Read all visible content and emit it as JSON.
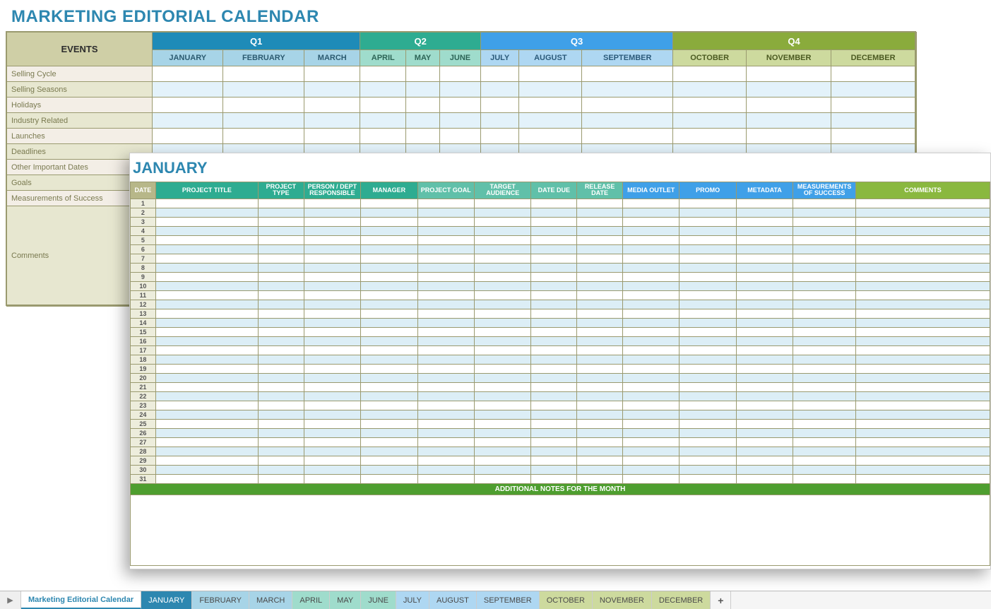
{
  "title": "MARKETING EDITORIAL CALENDAR",
  "eventsHeader": "EVENTS",
  "quarters": {
    "q1": {
      "label": "Q1",
      "months": [
        "JANUARY",
        "FEBRUARY",
        "MARCH"
      ]
    },
    "q2": {
      "label": "Q2",
      "months": [
        "APRIL",
        "MAY",
        "JUNE"
      ]
    },
    "q3": {
      "label": "Q3",
      "months": [
        "JULY",
        "AUGUST",
        "SEPTEMBER"
      ]
    },
    "q4": {
      "label": "Q4",
      "months": [
        "OCTOBER",
        "NOVEMBER",
        "DECEMBER"
      ]
    }
  },
  "rows": [
    "Selling Cycle",
    "Selling Seasons",
    "Holidays",
    "Industry Related",
    "Launches",
    "Deadlines",
    "Other Important Dates",
    "Goals",
    "Measurements of Success",
    "Comments"
  ],
  "overlay": {
    "title": "JANUARY",
    "headers": [
      "DATE",
      "PROJECT TITLE",
      "PROJECT TYPE",
      "PERSON / DEPT RESPONSIBLE",
      "MANAGER",
      "PROJECT GOAL",
      "TARGET AUDIENCE",
      "DATE DUE",
      "RELEASE DATE",
      "MEDIA OUTLET",
      "PROMO",
      "METADATA",
      "MEASUREMENTS OF SUCCESS",
      "COMMENTS"
    ],
    "days": 31,
    "notesLabel": "ADDITIONAL NOTES FOR THE MONTH"
  },
  "tabs": [
    "Marketing Editorial Calendar",
    "JANUARY",
    "FEBRUARY",
    "MARCH",
    "APRIL",
    "MAY",
    "JUNE",
    "JULY",
    "AUGUST",
    "SEPTEMBER",
    "OCTOBER",
    "NOVEMBER",
    "DECEMBER",
    "+"
  ]
}
